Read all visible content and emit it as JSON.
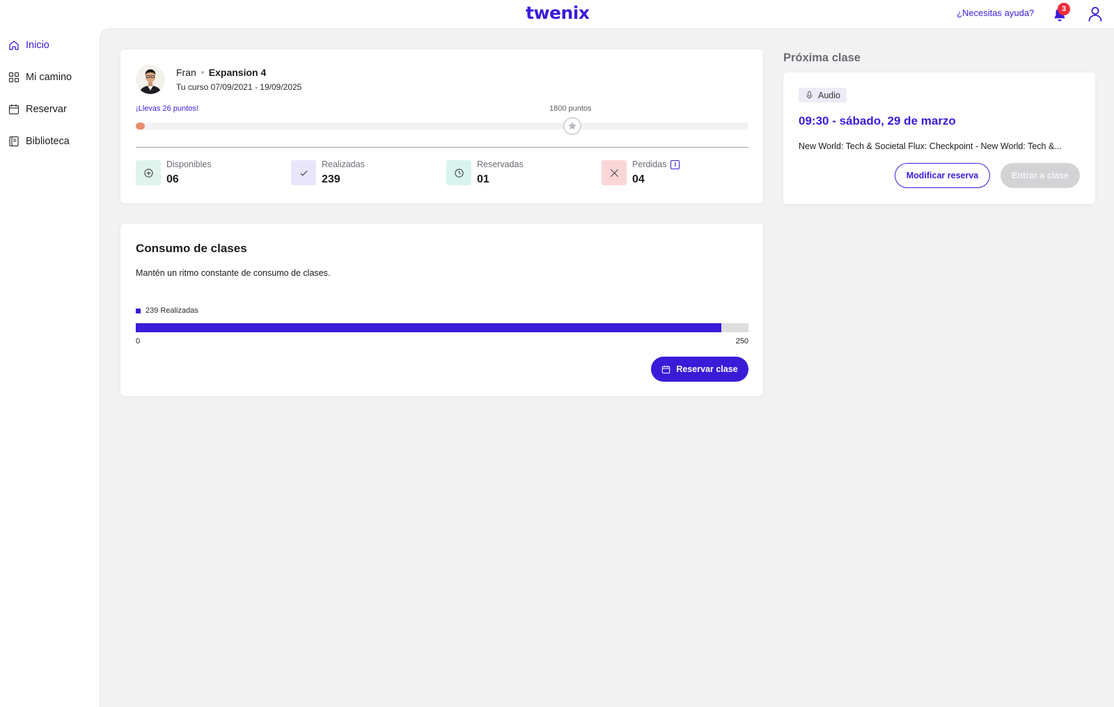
{
  "header": {
    "logo": "twenix",
    "help_link": "¿Necesitas ayuda?",
    "notifications_count": "3",
    "icons": [
      "bell-icon",
      "user-icon"
    ]
  },
  "sidebar": {
    "items": [
      {
        "label": "Inicio",
        "icon": "home-icon",
        "active": true
      },
      {
        "label": "Mi camino",
        "icon": "grid-icon",
        "active": false
      },
      {
        "label": "Reservar",
        "icon": "calendar-icon",
        "active": false
      },
      {
        "label": "Biblioteca",
        "icon": "book-icon",
        "active": false
      }
    ]
  },
  "profile": {
    "name": "Fran",
    "level": "Expansion 4",
    "course": "Tu curso 07/09/2021 - 19/09/2025",
    "points_earned": "¡Llevas 26 puntos!",
    "points_target": "1800 puntos",
    "points_value": 26,
    "points_max": 1800
  },
  "stats": [
    {
      "label": "Disponibles",
      "value": "06",
      "icon": "plus-circle-icon",
      "color": "#dff3ec"
    },
    {
      "label": "Realizadas",
      "value": "239",
      "icon": "check-icon",
      "color": "#e9e6fb"
    },
    {
      "label": "Reservadas",
      "value": "01",
      "icon": "clock-icon",
      "color": "#d9f4ee"
    },
    {
      "label": "Perdidas",
      "value": "04",
      "icon": "x-icon",
      "color": "#fbd6d6"
    }
  ],
  "next_class": {
    "section_title": "Próxima clase",
    "tag": "Audio",
    "datetime": "09:30 - sábado, 29 de marzo",
    "description": "New World: Tech & Societal Flux: Checkpoint - New World: Tech &...",
    "modify_label": "Modificar reserva",
    "enter_label": "Entrar a clase"
  },
  "consumption": {
    "title": "Consumo de clases",
    "subtitle": "Mantén un ritmo constante de consumo de clases.",
    "legend": "239 Realizadas",
    "axis_min": "0",
    "axis_max": "250",
    "done": 239,
    "total": 250,
    "button_label": "Reservar clase"
  },
  "colors": {
    "accent": "#3a1cd8",
    "progress_dot": "#e88c6c",
    "background": "#f2f2f2",
    "badge": "#ee2b3a"
  }
}
